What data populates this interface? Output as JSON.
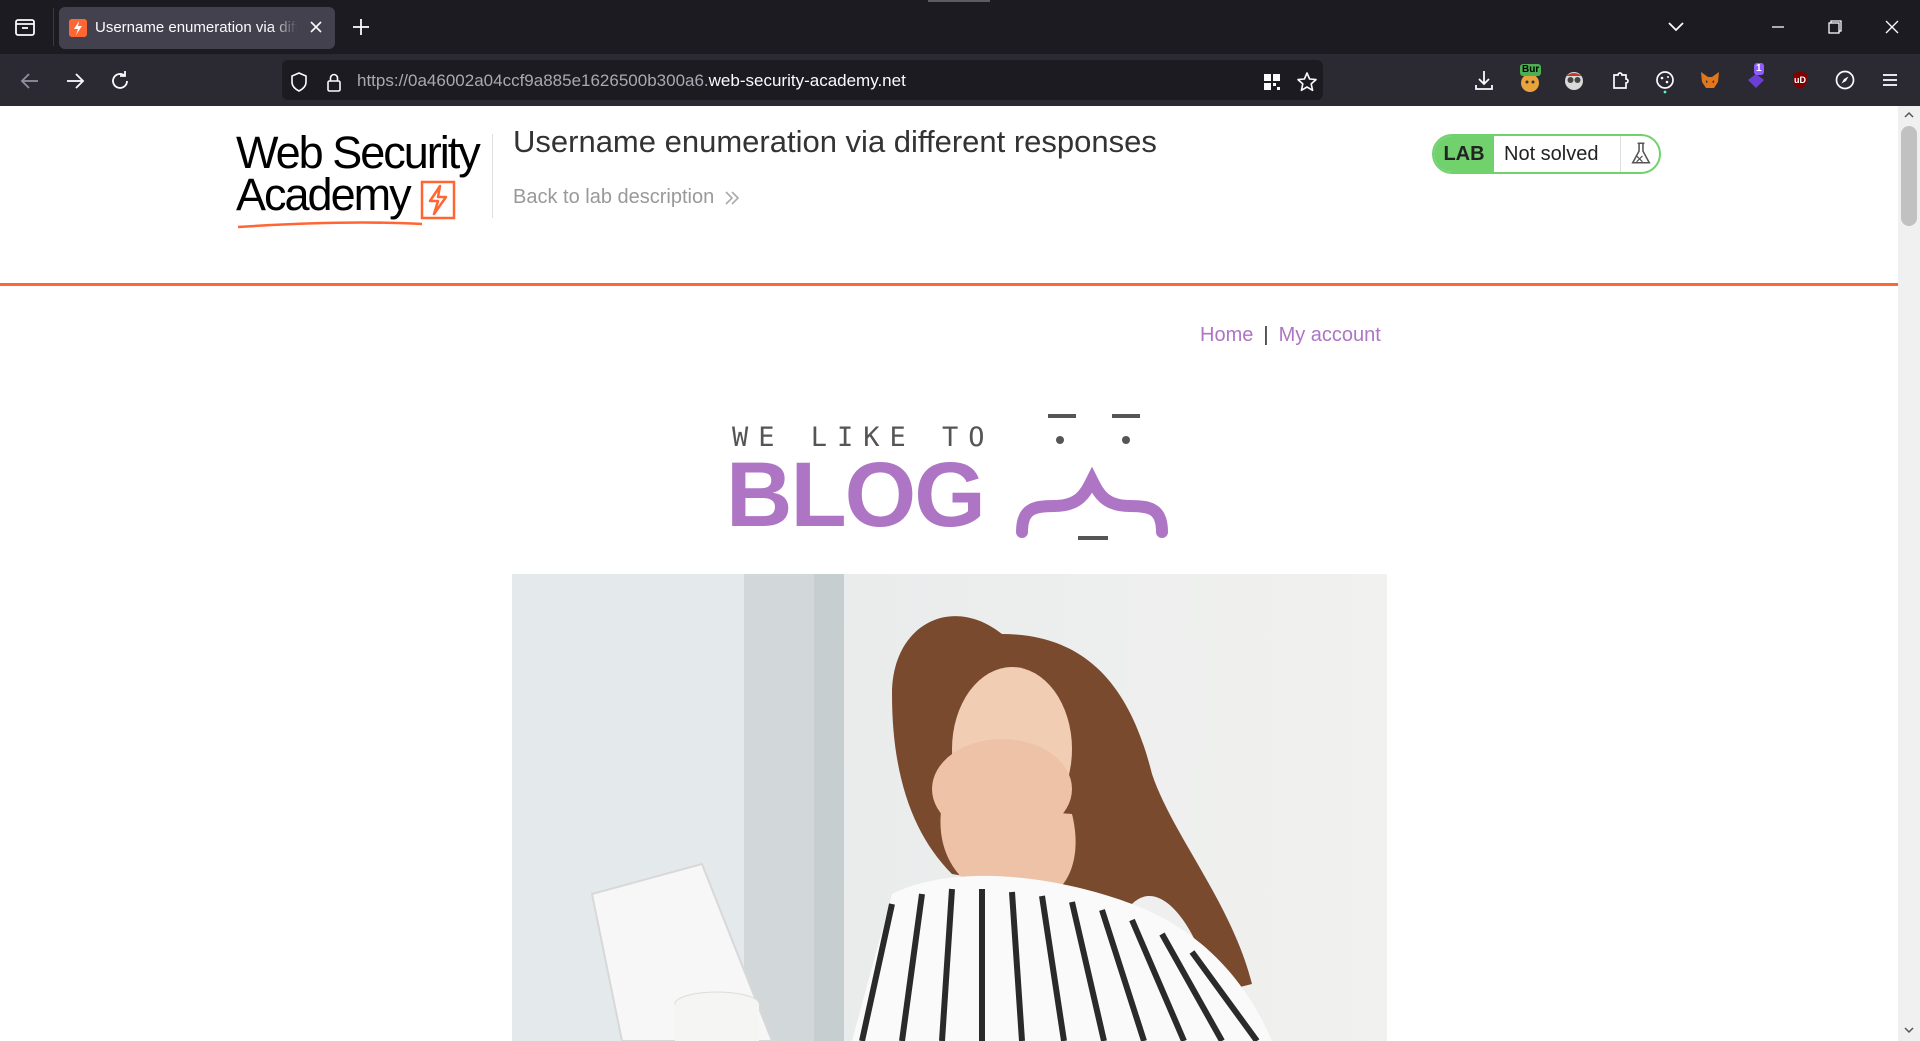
{
  "browser": {
    "tab_title": "Username enumeration via different responses",
    "url_prefix": "https://0a46002a04ccf9a885e1626500b300a6.",
    "url_domain": "web-security-academy.net",
    "extensions": {
      "burp_badge": "Bur",
      "notification_count": "1",
      "ublock_label": "uD"
    }
  },
  "header": {
    "logo_line1": "Web Security",
    "logo_line2": "Academy",
    "lab_title": "Username enumeration via different responses",
    "back_link": "Back to lab description",
    "lab_badge": "LAB",
    "lab_status": "Not solved"
  },
  "blog": {
    "nav": {
      "home": "Home",
      "separator": "|",
      "my_account": "My account"
    },
    "tagline": "WE LIKE TO",
    "wordmark": "BLOG"
  },
  "colors": {
    "accent_orange": "#ff6633",
    "blog_purple": "#ae75c5",
    "lab_green": "#70d16d"
  }
}
